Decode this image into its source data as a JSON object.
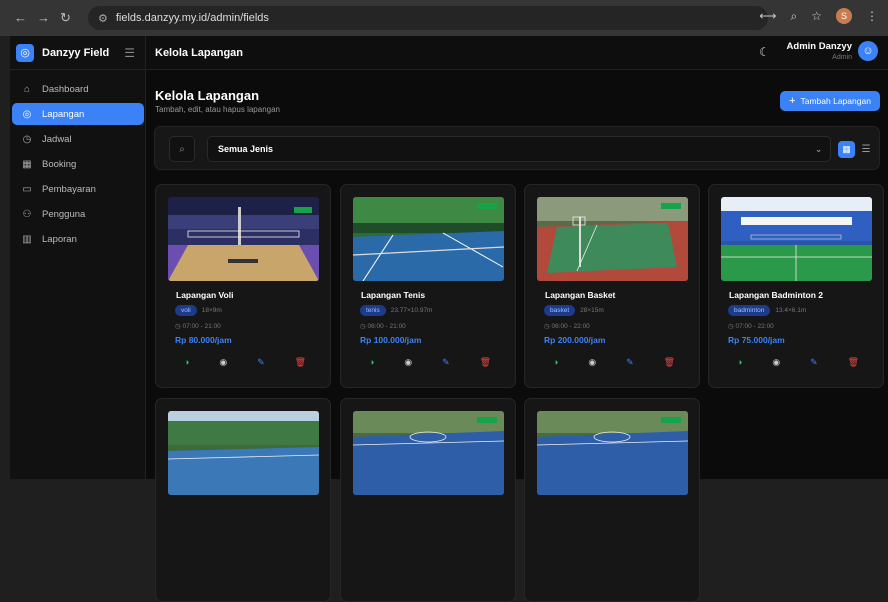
{
  "browser": {
    "url": "fields.danzyy.my.id/admin/fields"
  },
  "brand": {
    "name": "Danzyy Field"
  },
  "sidebar": {
    "items": [
      {
        "label": "Dashboard",
        "icon": "home-icon"
      },
      {
        "label": "Lapangan",
        "icon": "location-icon",
        "active": true
      },
      {
        "label": "Jadwal",
        "icon": "clock-icon"
      },
      {
        "label": "Booking",
        "icon": "calendar-icon"
      },
      {
        "label": "Pembayaran",
        "icon": "credit-card-icon"
      },
      {
        "label": "Pengguna",
        "icon": "users-icon"
      },
      {
        "label": "Laporan",
        "icon": "chart-icon"
      }
    ]
  },
  "header": {
    "title": "Kelola Lapangan",
    "user_name": "Admin Danzyy",
    "user_role": "Admin"
  },
  "page": {
    "title": "Kelola Lapangan",
    "subtitle": "Tambah, edit, atau hapus lapangan",
    "add_button": "Tambah Lapangan"
  },
  "filter": {
    "selected_type": "Semua Jenis"
  },
  "fields": [
    {
      "name": "Lapangan Voli",
      "type": "voli",
      "size": "18×9m",
      "hours": "07:00 - 21:00",
      "price": "Rp 80.000/jam"
    },
    {
      "name": "Lapangan Tenis",
      "type": "tenis",
      "size": "23.77×10.97m",
      "hours": "06:00 - 21:00",
      "price": "Rp 100.000/jam"
    },
    {
      "name": "Lapangan Basket",
      "type": "basket",
      "size": "28×15m",
      "hours": "06:00 - 22:00",
      "price": "Rp 200.000/jam"
    },
    {
      "name": "Lapangan Badminton 2",
      "type": "badminton",
      "size": "13.4×6.1m",
      "hours": "07:00 - 22:00",
      "price": "Rp 75.000/jam"
    }
  ],
  "colors": {
    "accent": "#3b82f6",
    "success": "#22c55e",
    "danger": "#ef4444"
  }
}
